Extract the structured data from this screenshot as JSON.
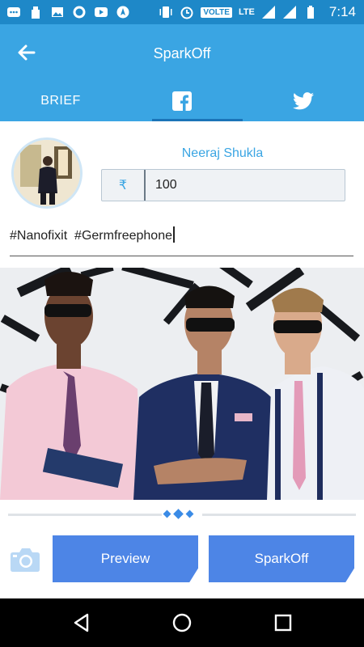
{
  "status_bar": {
    "time": "7:14",
    "volte": "VOLTE",
    "lte": "LTE"
  },
  "app_bar": {
    "title": "SparkOff"
  },
  "tabs": [
    {
      "label": "BRIEF",
      "active": false
    },
    {
      "icon": "facebook-icon",
      "active": true
    },
    {
      "icon": "twitter-icon",
      "active": false
    }
  ],
  "profile": {
    "name": "Neeraj Shukla"
  },
  "amount": {
    "currency_symbol": "₹",
    "value": "100"
  },
  "post": {
    "hashtags": "#Nanofixit  #Germfreephone"
  },
  "actions": {
    "preview_label": "Preview",
    "sparkoff_label": "SparkOff"
  },
  "colors": {
    "primary": "#3aa5e3",
    "status_bar": "#1e88c8",
    "button": "#4d85e6",
    "tab_indicator": "#1b74b8"
  }
}
